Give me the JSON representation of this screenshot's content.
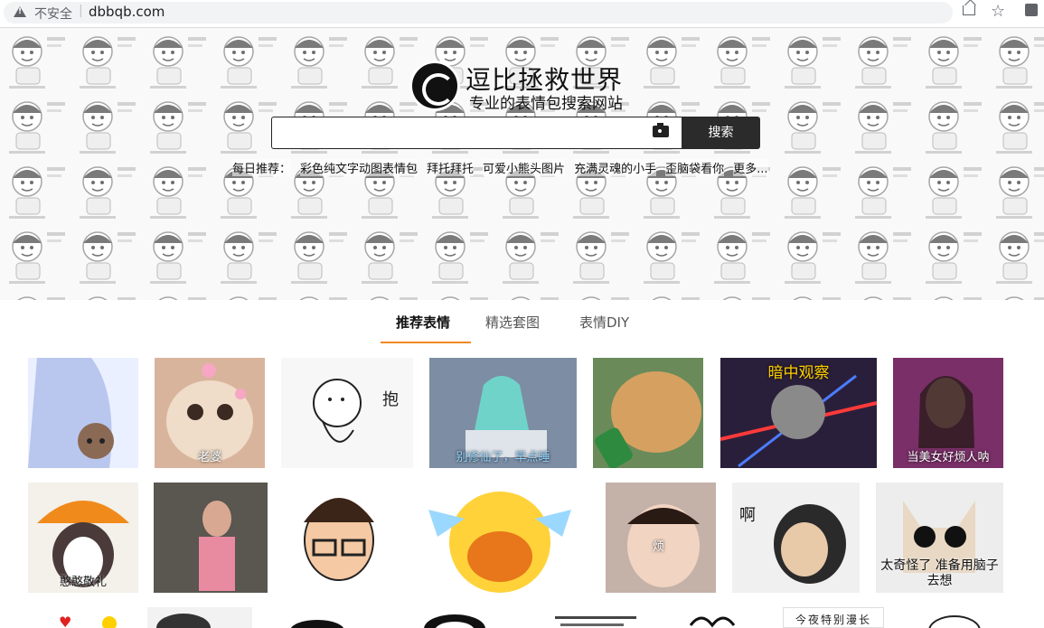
{
  "browser": {
    "security_label": "不安全",
    "separator": "|",
    "url": "dbbqb.com"
  },
  "icons": [
    "warning-icon",
    "share-icon",
    "star-icon",
    "extensions-icon",
    "camera-icon",
    "site-logo"
  ],
  "site": {
    "title": "逗比拯救世界",
    "subtitle": "专业的表情包搜索网站"
  },
  "search": {
    "placeholder": "",
    "value": "",
    "button_label": "搜索"
  },
  "daily": {
    "label": "每日推荐：",
    "items": [
      "彩色纯文字动图表情包",
      "拜托拜托",
      "可爱小熊头图片",
      "充满灵魂的小手",
      "歪脑袋看你",
      "更多..."
    ]
  },
  "tabs": [
    {
      "label": "推荐表情",
      "active": true
    },
    {
      "label": "精选套图",
      "active": false
    },
    {
      "label": "表情DIY",
      "active": false
    }
  ],
  "gallery": {
    "row1": [
      {
        "caption": "",
        "color": "#b9c7ee"
      },
      {
        "caption": "老婆",
        "color": "#d9b49c"
      },
      {
        "caption": "",
        "color": "#f7f7f7"
      },
      {
        "caption": "别修仙了，早点睡",
        "color": "#6d7e93"
      },
      {
        "caption": "",
        "color": "#c88a46"
      },
      {
        "caption": "暗中观察",
        "color": "#3a2a4a"
      },
      {
        "caption": "当美女好烦人呐",
        "color": "#8a3a6c"
      }
    ],
    "row2": [
      {
        "caption": "憨憨敬礼",
        "color": "#f4f0ea"
      },
      {
        "caption": "",
        "color": "#6e6a60"
      },
      {
        "caption": "",
        "color": "#ffffff"
      },
      {
        "caption": "",
        "color": "#ffe46b"
      },
      {
        "caption": "烦",
        "color": "#b7a298"
      },
      {
        "caption": "啊",
        "color": "#f0f0f0"
      },
      {
        "caption": "太奇怪了 准备用脑子去想",
        "color": "#ededed"
      }
    ],
    "row3_texts": [
      "今夜特别漫长"
    ]
  }
}
